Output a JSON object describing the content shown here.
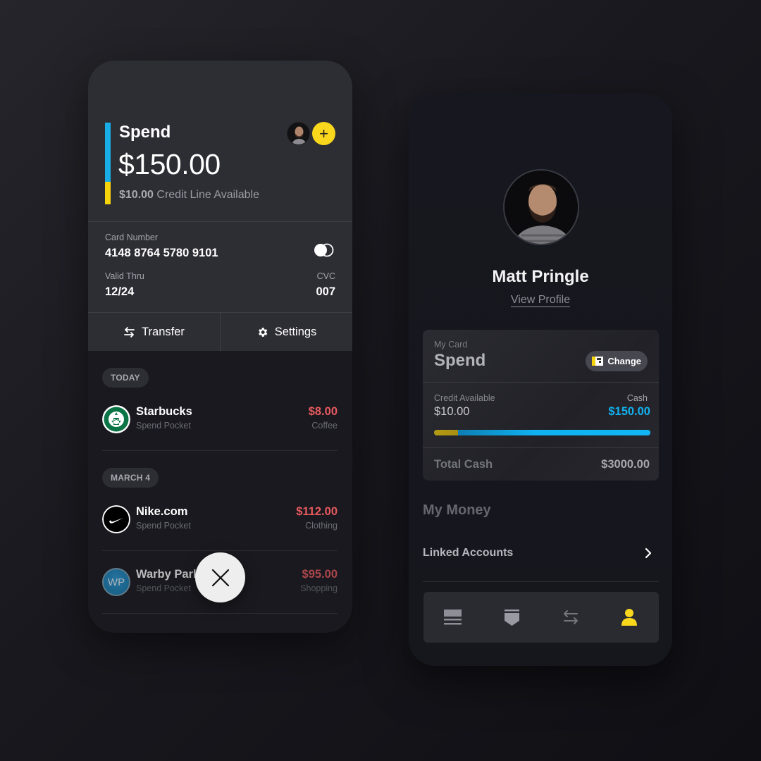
{
  "left_card": {
    "title": "Spend",
    "balance": "$150.00",
    "credit_amount": "$10.00",
    "credit_label": "Credit Line Available",
    "accent_colors": {
      "cash": "#17aee8",
      "credit": "#f6d40b"
    },
    "add_button_label": "+",
    "card_number_label": "Card Number",
    "card_number": "4148 8764 5780 9101",
    "valid_thru_label": "Valid Thru",
    "valid_thru": "12/24",
    "cvc_label": "CVC",
    "cvc": "007",
    "actions": [
      {
        "label": "Transfer",
        "icon": "transfer-arrows-icon"
      },
      {
        "label": "Settings",
        "icon": "gear-icon"
      }
    ],
    "groups": [
      {
        "date": "TODAY",
        "transactions": [
          {
            "merchant": "Starbucks",
            "pocket": "Spend Pocket",
            "amount": "$8.00",
            "category": "Coffee",
            "logo": "starbucks-logo"
          }
        ]
      },
      {
        "date": "MARCH 4",
        "transactions": [
          {
            "merchant": "Nike.com",
            "pocket": "Spend Pocket",
            "amount": "$112.00",
            "category": "Clothing",
            "logo": "nike-logo"
          },
          {
            "merchant": "Warby Parker",
            "pocket": "Spend Pocket",
            "amount": "$95.00",
            "category": "Shopping",
            "logo": "warby-parker-logo",
            "logo_text": "WP"
          }
        ]
      }
    ],
    "amount_color": "#e85a5e",
    "close_button": "close-icon"
  },
  "right_card": {
    "profile_name": "Matt Pringle",
    "view_profile": "View Profile",
    "my_card_label": "My Card",
    "my_card_name": "Spend",
    "change_label": "Change",
    "credit_available_label": "Credit Available",
    "credit_available": "$10.00",
    "cash_label": "Cash",
    "cash": "$150.00",
    "cash_color": "#12b2f0",
    "balance_split": {
      "credit_fraction": 0.11,
      "cash_fraction": 0.89
    },
    "total_cash_label": "Total Cash",
    "total_cash": "$3000.00",
    "my_money_heading": "My Money",
    "linked_accounts": "Linked Accounts",
    "nav_items": [
      {
        "icon": "cards-list-icon",
        "active": false
      },
      {
        "icon": "pocket-icon",
        "active": false
      },
      {
        "icon": "transfer-arrows-icon",
        "active": false
      },
      {
        "icon": "profile-person-icon",
        "active": true
      }
    ],
    "active_color": "#f9d71c"
  }
}
